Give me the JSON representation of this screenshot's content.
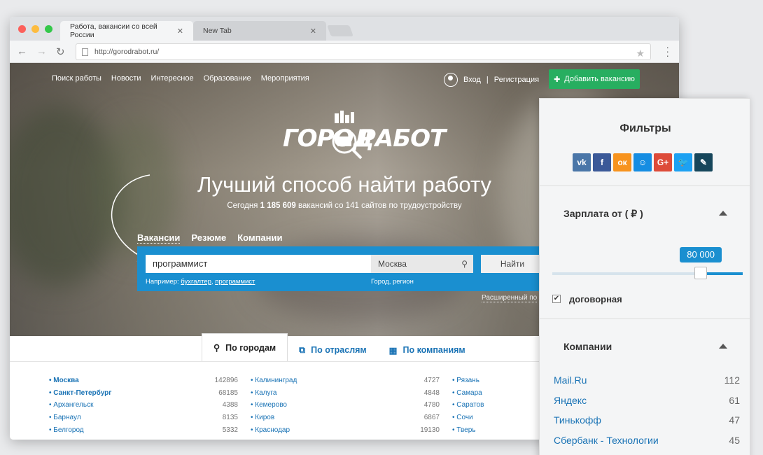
{
  "browser": {
    "tabs": [
      {
        "title": "Работа, вакансии со всей России",
        "close": "✕"
      },
      {
        "title": "New Tab",
        "close": "✕"
      }
    ],
    "url": "http://gorodrabot.ru/"
  },
  "header": {
    "nav": [
      "Поиск работы",
      "Новости",
      "Интересное",
      "Образование",
      "Мероприятия"
    ],
    "login": "Вход",
    "divider": "|",
    "register": "Регистрация",
    "add_vacancy": "Добавить вакансию"
  },
  "logo": {
    "left": "ГОРОД",
    "right": "РАБОТ"
  },
  "hero": {
    "headline": "Лучший способ найти работу",
    "sub_prefix": "Сегодня",
    "sub_count": "1 185 609",
    "sub_mid": "вакансий со",
    "sub_sites": "141",
    "sub_suffix": "сайтов по трудоустройству"
  },
  "search": {
    "tabs": [
      "Вакансии",
      "Резюме",
      "Компании"
    ],
    "query": "программист",
    "city": "Москва",
    "find_button": "Найти",
    "example_prefix": "Например:",
    "example_1": "бухгалтер",
    "example_sep": ",",
    "example_2": "программист",
    "city_hint": "Город, регион",
    "advanced": "Расширенный по"
  },
  "content_tabs": [
    "По городам",
    "По отраслям",
    "По компаниям"
  ],
  "cities": [
    [
      {
        "name": "Москва",
        "count": "142896",
        "bold": true
      },
      {
        "name": "Санкт-Петербург",
        "count": "68185",
        "bold": true
      },
      {
        "name": "Архангельск",
        "count": "4388"
      },
      {
        "name": "Барнаул",
        "count": "8135"
      },
      {
        "name": "Белгород",
        "count": "5332"
      }
    ],
    [
      {
        "name": "Калининград",
        "count": "4727"
      },
      {
        "name": "Калуга",
        "count": "4848"
      },
      {
        "name": "Кемерово",
        "count": "4780"
      },
      {
        "name": "Киров",
        "count": "6867"
      },
      {
        "name": "Краснодар",
        "count": "19130"
      }
    ],
    [
      {
        "name": "Рязань",
        "count": ""
      },
      {
        "name": "Самара",
        "count": ""
      },
      {
        "name": "Саратов",
        "count": ""
      },
      {
        "name": "Сочи",
        "count": ""
      },
      {
        "name": "Тверь",
        "count": ""
      }
    ]
  ],
  "filters": {
    "title": "Фильтры",
    "socials": [
      {
        "name": "vk-icon",
        "glyph": "vk",
        "color": "#4a76a8"
      },
      {
        "name": "facebook-icon",
        "glyph": "f",
        "color": "#3b5998"
      },
      {
        "name": "odnoklassniki-icon",
        "glyph": "ок",
        "color": "#f7931e"
      },
      {
        "name": "moimir-icon",
        "glyph": "☺",
        "color": "#168de2"
      },
      {
        "name": "googleplus-icon",
        "glyph": "G+",
        "color": "#dd4b39"
      },
      {
        "name": "twitter-icon",
        "glyph": "🐦",
        "color": "#1da1f2"
      },
      {
        "name": "livejournal-icon",
        "glyph": "✎",
        "color": "#16465b"
      }
    ],
    "salary_title": "Зарплата от ( ₽ )",
    "salary_value": "80 000",
    "salary_fraction": 0.78,
    "negotiable_label": "договорная",
    "negotiable_checked": true,
    "companies_title": "Компании",
    "companies": [
      {
        "name": "Mail.Ru",
        "count": "112"
      },
      {
        "name": "Яндекс",
        "count": "61"
      },
      {
        "name": "Тинькофф",
        "count": "47"
      },
      {
        "name": "Сбербанк - Технологии",
        "count": "45"
      }
    ]
  }
}
